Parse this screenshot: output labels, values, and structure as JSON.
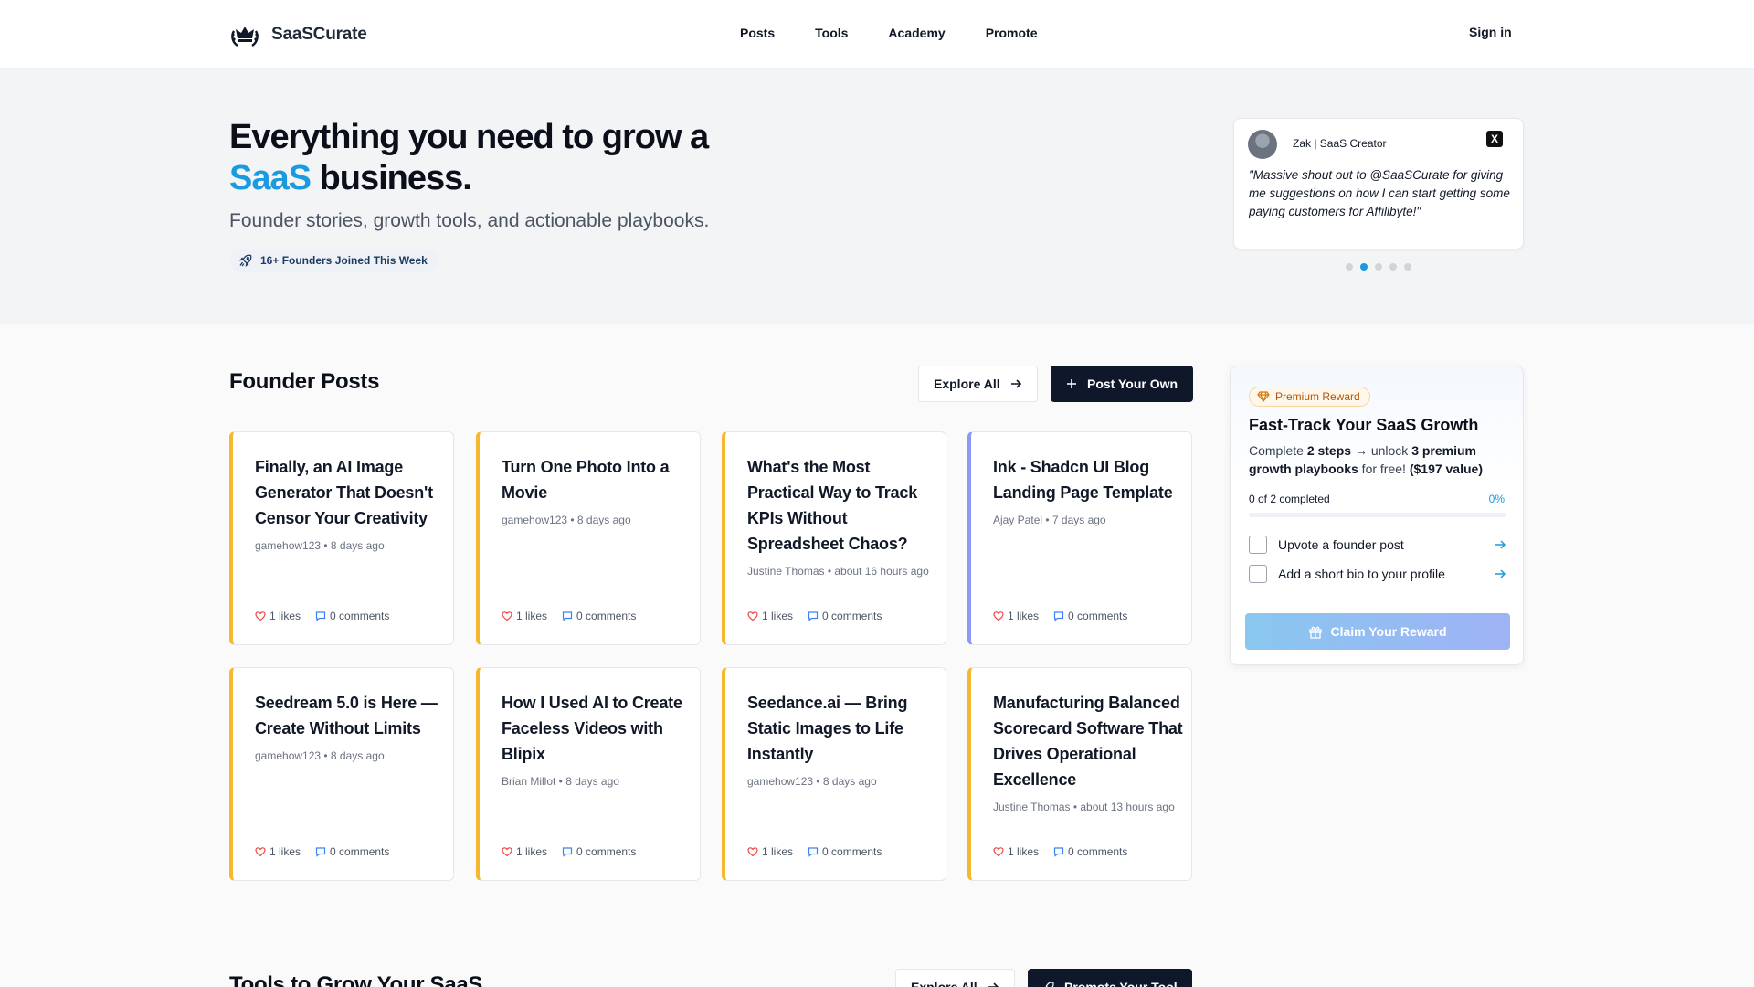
{
  "brand": {
    "name": "SaaSCurate"
  },
  "nav": {
    "items": [
      "Posts",
      "Tools",
      "Academy",
      "Promote"
    ],
    "signin": "Sign in"
  },
  "hero": {
    "title_line1": "Everything you need to grow a",
    "title_accent": "SaaS",
    "title_line2_rest": " business.",
    "subtitle": "Founder stories, growth tools, and actionable playbooks.",
    "joined": "16+ Founders Joined This Week"
  },
  "testimonial": {
    "name": "Zak | SaaS Creator",
    "x_label": "X",
    "quote": "\"Massive shout out to @SaaSCurate for giving me suggestions on how I can start getting some paying customers for Affilibyte!\"",
    "active_dot": 1,
    "dot_count": 5
  },
  "founder_posts": {
    "title": "Founder Posts",
    "explore_label": "Explore All",
    "post_label": "Post Your Own",
    "cards": [
      {
        "title": "Finally, an AI Image Generator That Doesn't Censor Your Creativity",
        "meta": "gamehow123 • 8 days ago",
        "likes": "1 likes",
        "comments": "0 comments"
      },
      {
        "title": "Turn One Photo Into a Movie",
        "meta": "gamehow123 • 8 days ago",
        "likes": "1 likes",
        "comments": "0 comments"
      },
      {
        "title": "What's the Most Practical Way to Track KPIs Without Spreadsheet Chaos?",
        "meta": "Justine Thomas • about 16 hours ago",
        "likes": "1 likes",
        "comments": "0 comments"
      },
      {
        "title": "Ink - Shadcn UI Blog Landing Page Template",
        "meta": "Ajay Patel • 7 days ago",
        "likes": "1 likes",
        "comments": "0 comments"
      },
      {
        "title": "Seedream 5.0 is Here — Create Without Limits",
        "meta": "gamehow123 • 8 days ago",
        "likes": "1 likes",
        "comments": "0 comments"
      },
      {
        "title": "How I Used AI to Create Faceless Videos with Blipix",
        "meta": "Brian Millot • 8 days ago",
        "likes": "1 likes",
        "comments": "0 comments"
      },
      {
        "title": "Seedance.ai — Bring Static Images to Life Instantly",
        "meta": "gamehow123 • 8 days ago",
        "likes": "1 likes",
        "comments": "0 comments"
      },
      {
        "title": "Manufacturing Balanced Scorecard Software That Drives Operational Excellence",
        "meta": "Justine Thomas • about 13 hours ago",
        "likes": "1 likes",
        "comments": "0 comments"
      }
    ]
  },
  "reward": {
    "badge": "Premium Reward",
    "title": "Fast-Track Your SaaS Growth",
    "desc_1": "Complete ",
    "desc_steps": "2 steps",
    "desc_2": " → unlock ",
    "desc_playbooks": "3 premium growth playbooks",
    "desc_3": " for free! ",
    "desc_value": "($197 value)",
    "progress_label": "0 of 2 completed",
    "progress_pct": "0%",
    "progress_value": 0,
    "tasks": [
      "Upvote a founder post",
      "Add a short bio to your profile"
    ],
    "claim_label": "Claim Your Reward"
  },
  "tools_section": {
    "title": "Tools to Grow Your SaaS",
    "explore_label": "Explore All",
    "promote_label": "Promote Your Tool"
  }
}
